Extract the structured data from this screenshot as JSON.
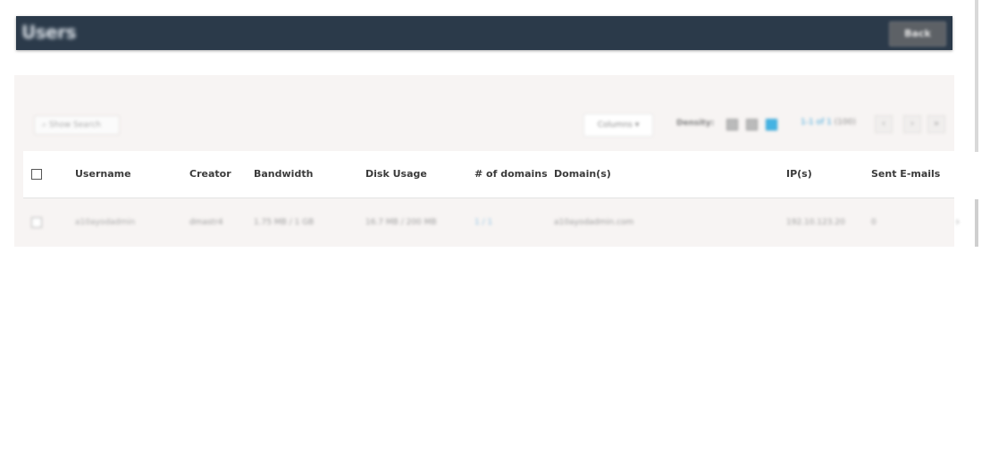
{
  "header": {
    "title": "Users",
    "action_label": "Back"
  },
  "toolbar": {
    "search_placeholder": "Show Search",
    "columns_label": "Columns",
    "density_label": "Density:",
    "pagination": {
      "range": "1-1 of 1",
      "total": "(100)"
    },
    "prev_label": "‹",
    "next_label": "›",
    "last_label": "»"
  },
  "table": {
    "columns": [
      "Username",
      "Creator",
      "Bandwidth",
      "Disk Usage",
      "# of domains",
      "Domain(s)",
      "IP(s)",
      "Sent E-mails"
    ],
    "rows": [
      {
        "username": "a10ayodadmin",
        "creator": "dmastr4",
        "bandwidth": "1.75 MB / 1 GB",
        "disk_usage": "16.7 MB / 200 MB",
        "domains_count": "1 / 1",
        "domains": "a10ayodadmin.com",
        "ips": "192.10.123.20",
        "sent_emails": "0"
      }
    ]
  },
  "colors": {
    "header_bg": "#2b3a4a",
    "accent": "#45b3e3",
    "panel_bg": "#f7f4f3"
  },
  "icons": {
    "search": "search-icon",
    "dropdown": "chevron-down-icon",
    "density": [
      "density-compact-icon",
      "density-normal-icon",
      "density-comfortable-icon"
    ],
    "row_expand": "chevron-right-icon"
  }
}
